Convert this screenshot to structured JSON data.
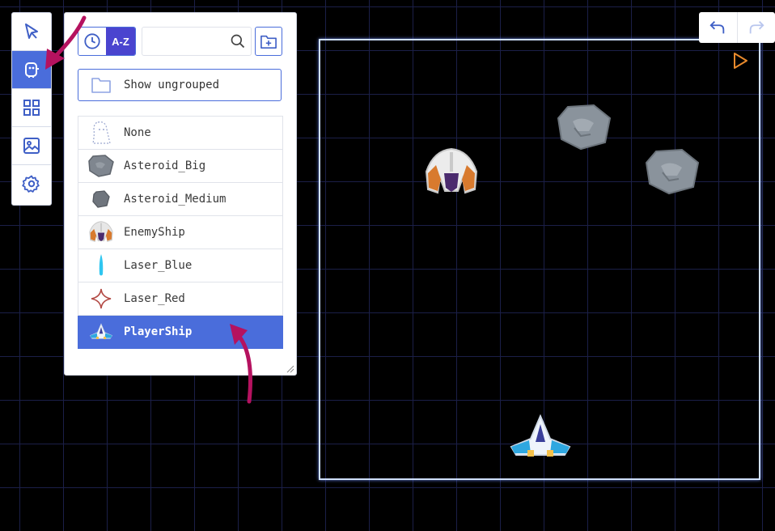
{
  "toolbar": {
    "tools": [
      {
        "name": "select-tool",
        "icon": "cursor-arrow-icon",
        "active": false
      },
      {
        "name": "objects-tool",
        "icon": "sprite-object-icon",
        "active": true
      },
      {
        "name": "tiles-tool",
        "icon": "grid-tiles-icon",
        "active": false
      },
      {
        "name": "backgrounds-tool",
        "icon": "image-icon",
        "active": false
      },
      {
        "name": "settings-tool",
        "icon": "gear-icon",
        "active": false
      }
    ]
  },
  "panel": {
    "sort_az_label": "A-Z",
    "search_placeholder": "",
    "show_ungrouped_label": "Show ungrouped",
    "items": [
      {
        "name": "None",
        "thumb": "ghost-icon",
        "selected": false
      },
      {
        "name": "Asteroid_Big",
        "thumb": "asteroid-big-icon",
        "selected": false
      },
      {
        "name": "Asteroid_Medium",
        "thumb": "asteroid-medium-icon",
        "selected": false
      },
      {
        "name": "EnemyShip",
        "thumb": "enemy-ship-icon",
        "selected": false
      },
      {
        "name": "Laser_Blue",
        "thumb": "laser-blue-icon",
        "selected": false
      },
      {
        "name": "Laser_Red",
        "thumb": "laser-red-icon",
        "selected": false
      },
      {
        "name": "PlayerShip",
        "thumb": "player-ship-icon",
        "selected": true
      }
    ]
  },
  "colors": {
    "accent": "#4a6ddb",
    "sort_active": "#4a44cf",
    "annotation_arrow": "#b5125f",
    "play": "#e98a2c",
    "stage_border": "#cfe0ff"
  }
}
